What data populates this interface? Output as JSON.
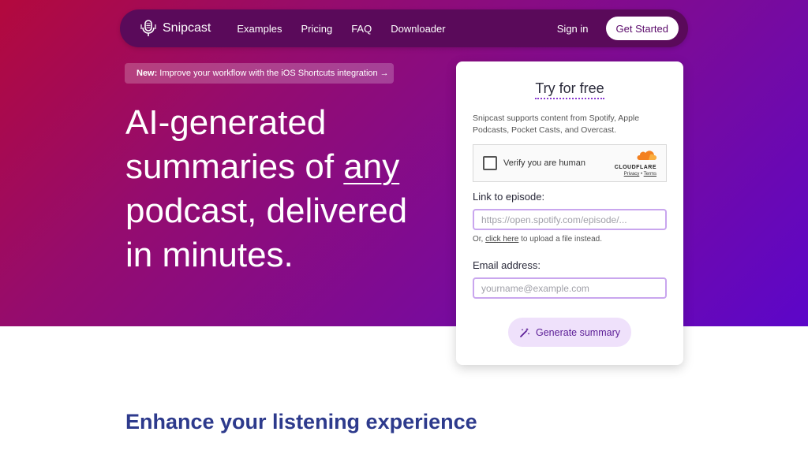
{
  "nav": {
    "brand": "Snipcast",
    "links": [
      "Examples",
      "Pricing",
      "FAQ",
      "Downloader"
    ],
    "signin": "Sign in",
    "cta": "Get Started"
  },
  "announce": {
    "prefix": "New:",
    "text": "Improve your workflow with the iOS Shortcuts integration →"
  },
  "hero": {
    "line1": "AI-generated",
    "line2_pre": "summaries of ",
    "line2_underlined": "any",
    "line3": "podcast, delivered",
    "line4": "in minutes."
  },
  "card": {
    "title": "Try for free",
    "support": "Snipcast supports content from Spotify, Apple Podcasts, Pocket Casts, and Overcast.",
    "captcha": {
      "label": "Verify you are human",
      "brand": "CLOUDFLARE",
      "privacy": "Privacy",
      "separator": "•",
      "terms": "Terms"
    },
    "link_label": "Link to episode:",
    "link_placeholder": "https://open.spotify.com/episode/...",
    "helper_pre": "Or, ",
    "helper_link": "click here",
    "helper_post": " to upload a file instead.",
    "email_label": "Email address:",
    "email_placeholder": "yourname@example.com",
    "button": "Generate summary"
  },
  "section": {
    "title": "Enhance your listening experience"
  },
  "colors": {
    "gradient_start": "#b3093d",
    "gradient_end": "#5c06c9",
    "navbar": "#5a0a5a",
    "accent": "#5b1d96",
    "section_title": "#2d3a8c"
  }
}
